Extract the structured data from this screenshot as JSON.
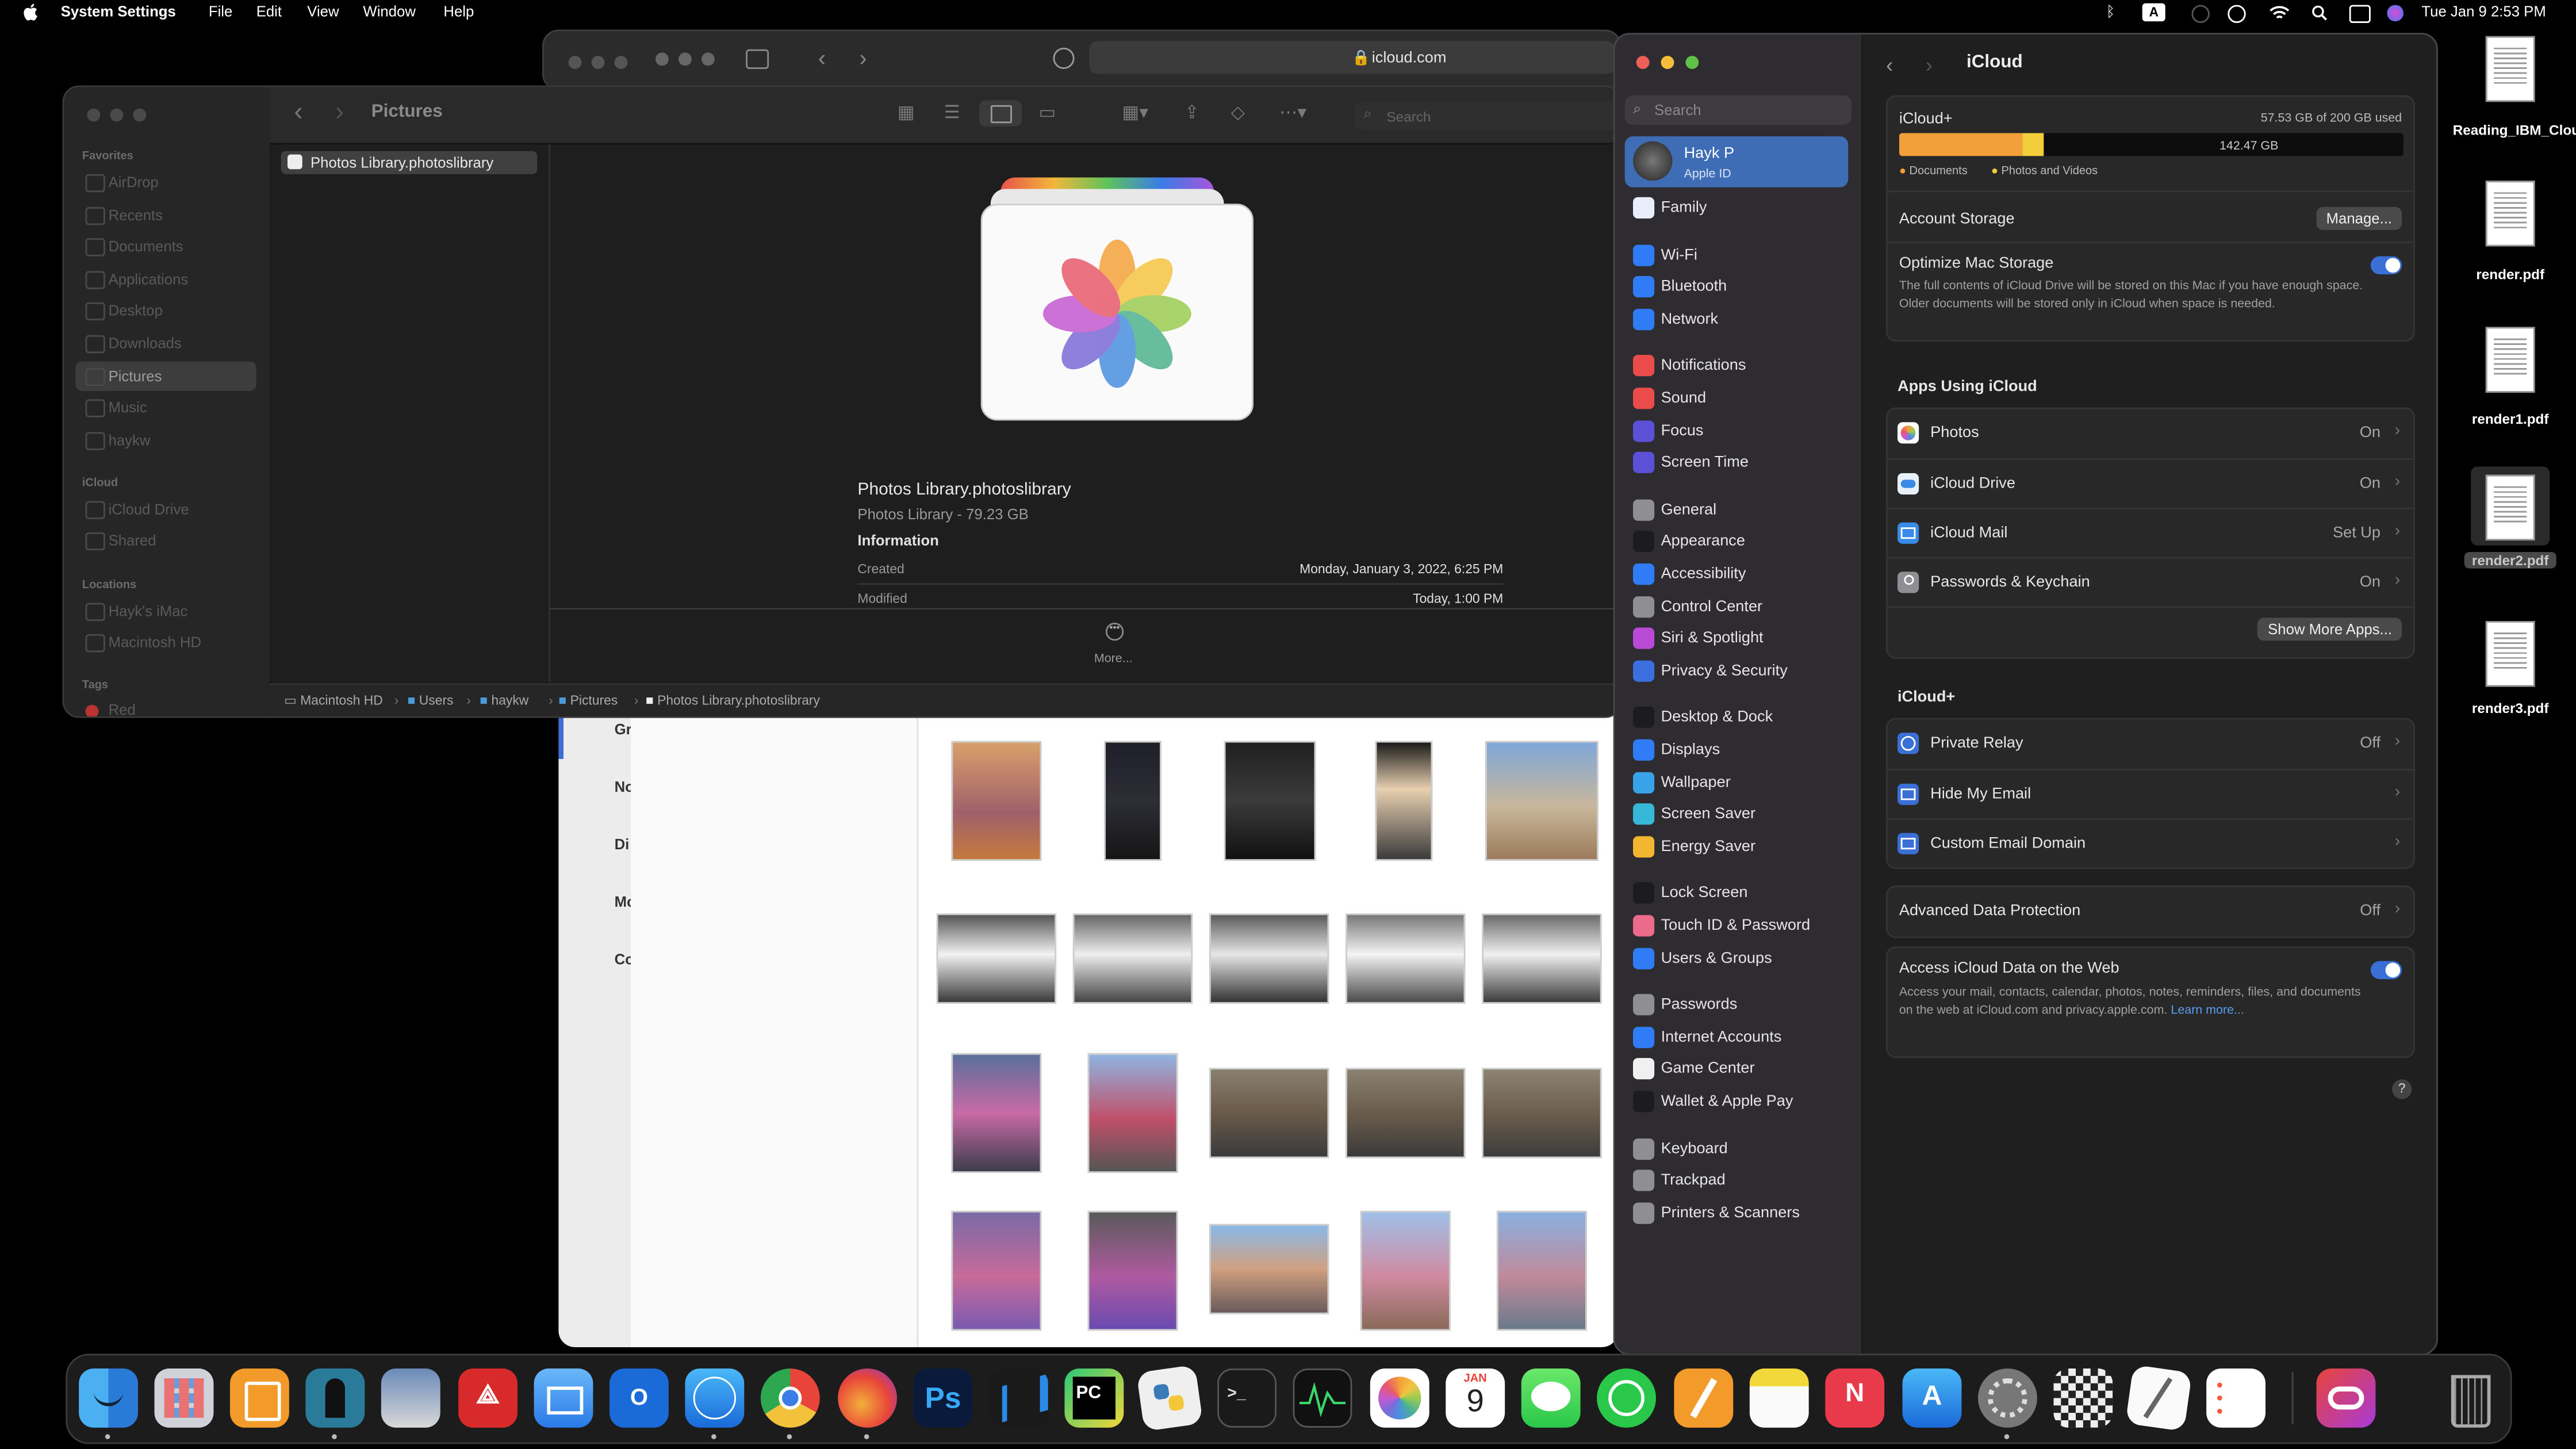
{
  "menubar": {
    "app_name": "System Settings",
    "menus": [
      "File",
      "Edit",
      "View",
      "Window",
      "Help"
    ],
    "input_badge": "A",
    "datetime": "Tue Jan 9  2:53 PM"
  },
  "safari": {
    "url": "icloud.com"
  },
  "photos_app": {
    "sidebar_partial_labels": [
      "Gr",
      "No",
      "Di",
      "Mo",
      "Co"
    ]
  },
  "finder": {
    "title": "Pictures",
    "search_placeholder": "Search",
    "sidebar": {
      "favorites_header": "Favorites",
      "favorites": [
        "AirDrop",
        "Recents",
        "Documents",
        "Applications",
        "Desktop",
        "Downloads",
        "Pictures",
        "Music",
        "haykw"
      ],
      "icloud_header": "iCloud",
      "icloud": [
        "iCloud Drive",
        "Shared"
      ],
      "locations_header": "Locations",
      "locations": [
        "Hayk's iMac",
        "Macintosh HD"
      ],
      "tags_header": "Tags",
      "tags": [
        "Red"
      ]
    },
    "column_item": "Photos Library.photoslibrary",
    "preview": {
      "name": "Photos Library.photoslibrary",
      "kind": "Photos Library - 79.23 GB",
      "info_header": "Information",
      "created_label": "Created",
      "created_value": "Monday, January 3, 2022, 6:25 PM",
      "modified_label": "Modified",
      "modified_value": "Today, 1:00 PM",
      "more_label": "More..."
    },
    "path": [
      "Macintosh HD",
      "Users",
      "haykw",
      "Pictures",
      "Photos Library.photoslibrary"
    ]
  },
  "settings": {
    "search_placeholder": "Search",
    "account": {
      "name": "Hayk P",
      "sub": "Apple ID"
    },
    "sidebar_groups": [
      [
        {
          "label": "Family",
          "icon": "family-icon",
          "color": "#e9eefc"
        }
      ],
      [
        {
          "label": "Wi-Fi",
          "icon": "wifi-icon",
          "color": "#2f7cf6"
        },
        {
          "label": "Bluetooth",
          "icon": "bluetooth-icon",
          "color": "#2f7cf6"
        },
        {
          "label": "Network",
          "icon": "network-icon",
          "color": "#2f7cf6"
        }
      ],
      [
        {
          "label": "Notifications",
          "icon": "notifications-icon",
          "color": "#ec4b4b"
        },
        {
          "label": "Sound",
          "icon": "sound-icon",
          "color": "#ec4b4b"
        },
        {
          "label": "Focus",
          "icon": "focus-icon",
          "color": "#5b50d6"
        },
        {
          "label": "Screen Time",
          "icon": "screen-time-icon",
          "color": "#5b50d6"
        }
      ],
      [
        {
          "label": "General",
          "icon": "gear-icon",
          "color": "#8e8e93"
        },
        {
          "label": "Appearance",
          "icon": "appearance-icon",
          "color": "#1c1c1e"
        },
        {
          "label": "Accessibility",
          "icon": "accessibility-icon",
          "color": "#2f7cf6"
        },
        {
          "label": "Control Center",
          "icon": "control-center-icon",
          "color": "#8e8e93"
        },
        {
          "label": "Siri & Spotlight",
          "icon": "siri-icon",
          "color": "#b84ad6"
        },
        {
          "label": "Privacy & Security",
          "icon": "hand-icon",
          "color": "#3b6fe0"
        }
      ],
      [
        {
          "label": "Desktop & Dock",
          "icon": "desktop-dock-icon",
          "color": "#1c1c1e"
        },
        {
          "label": "Displays",
          "icon": "displays-icon",
          "color": "#2f7cf6"
        },
        {
          "label": "Wallpaper",
          "icon": "wallpaper-icon",
          "color": "#38a3e8"
        },
        {
          "label": "Screen Saver",
          "icon": "screen-saver-icon",
          "color": "#38b8d8"
        },
        {
          "label": "Energy Saver",
          "icon": "energy-saver-icon",
          "color": "#f2b630"
        }
      ],
      [
        {
          "label": "Lock Screen",
          "icon": "lock-icon",
          "color": "#1c1c1e"
        },
        {
          "label": "Touch ID & Password",
          "icon": "fingerprint-icon",
          "color": "#ec6a8a"
        },
        {
          "label": "Users & Groups",
          "icon": "users-icon",
          "color": "#2f7cf6"
        }
      ],
      [
        {
          "label": "Passwords",
          "icon": "key-icon",
          "color": "#8e8e93"
        },
        {
          "label": "Internet Accounts",
          "icon": "at-icon",
          "color": "#2f7cf6"
        },
        {
          "label": "Game Center",
          "icon": "game-center-icon",
          "color": "#f0f0f0"
        },
        {
          "label": "Wallet & Apple Pay",
          "icon": "wallet-icon",
          "color": "#1c1c1e"
        }
      ],
      [
        {
          "label": "Keyboard",
          "icon": "keyboard-icon",
          "color": "#8e8e93"
        },
        {
          "label": "Trackpad",
          "icon": "trackpad-icon",
          "color": "#8e8e93"
        },
        {
          "label": "Printers & Scanners",
          "icon": "printer-icon",
          "color": "#8e8e93"
        }
      ]
    ],
    "main": {
      "title": "iCloud",
      "storage_label": "iCloud+",
      "storage_used": "57.53 GB of 200 GB used",
      "storage_free": "142.47 GB",
      "storage_segments": [
        {
          "label": "Documents",
          "fraction": 0.245,
          "color": "#f2a13a"
        },
        {
          "label": "Photos and Videos",
          "fraction": 0.043,
          "color": "#f2cf3a"
        }
      ],
      "account_storage": "Account Storage",
      "manage_button": "Manage...",
      "optimize_title": "Optimize Mac Storage",
      "optimize_desc": "The full contents of iCloud Drive will be stored on this Mac if you have enough space. Older documents will be stored only in iCloud when space is needed.",
      "apps_header": "Apps Using iCloud",
      "apps": [
        {
          "label": "Photos",
          "value": "On",
          "icon": "photos-icon"
        },
        {
          "label": "iCloud Drive",
          "value": "On",
          "icon": "icloud-drive-icon"
        },
        {
          "label": "iCloud Mail",
          "value": "Set Up",
          "icon": "mail-icon"
        },
        {
          "label": "Passwords & Keychain",
          "value": "On",
          "icon": "key-icon"
        }
      ],
      "show_more": "Show More Apps...",
      "plus_header": "iCloud+",
      "plus": [
        {
          "label": "Private Relay",
          "value": "Off",
          "icon": "private-relay-icon"
        },
        {
          "label": "Hide My Email",
          "value": "",
          "icon": "hide-email-icon"
        },
        {
          "label": "Custom Email Domain",
          "value": "",
          "icon": "custom-domain-icon"
        }
      ],
      "adp_label": "Advanced Data Protection",
      "adp_value": "Off",
      "web_title": "Access iCloud Data on the Web",
      "web_desc": "Access your mail, contacts, calendar, photos, notes, reminders, files, and documents on the web at iCloud.com and privacy.apple.com.",
      "web_link": "Learn more...",
      "help": "?"
    }
  },
  "desktop_files": [
    "Reading_IBM_Cloud_Gallery.pdf",
    "render.pdf",
    "render1.pdf",
    "render2.pdf",
    "render3.pdf"
  ],
  "dock": {
    "calendar_month": "JAN",
    "calendar_day": "9",
    "ps_label": "Ps",
    "pc_label": "PC"
  }
}
